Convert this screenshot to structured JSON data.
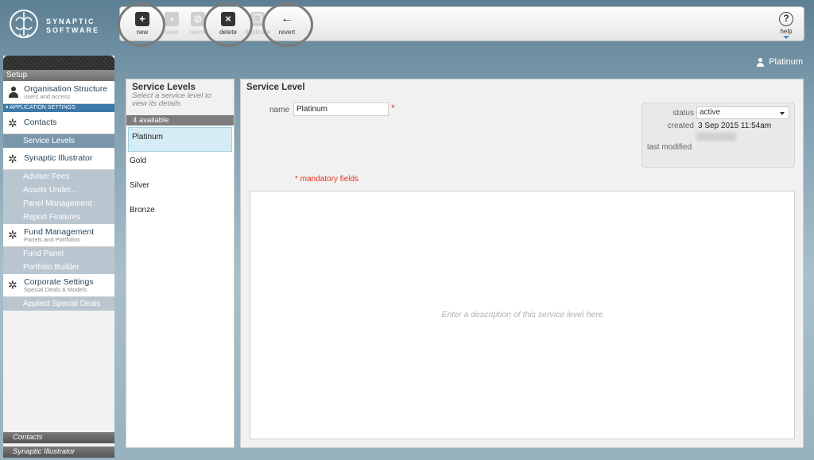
{
  "brand": {
    "line1": "SYNAPTIC",
    "line2": "SOFTWARE"
  },
  "toolbar": {
    "new_label": "new",
    "save_label": "save",
    "cancel_label": "cancel",
    "delete_label": "delete",
    "duplicate_label": "duplicate",
    "revert_label": "revert",
    "help_label": "help"
  },
  "user": {
    "name": "Platinum"
  },
  "sidebar": {
    "setup_label": "Setup",
    "org": {
      "label": "Organisation Structure",
      "sub": "users and access"
    },
    "app_settings_label": "APPLICATION SETTINGS",
    "contacts": {
      "label": "Contacts"
    },
    "service_levels_label": "Service Levels",
    "illustrator": {
      "label": "Synaptic Illustrator"
    },
    "illustrator_sub": [
      "Adviser Fees",
      "Assets Under...",
      "Panel Management",
      "Report Features"
    ],
    "fund": {
      "label": "Fund Management",
      "sub": "Panels and Portfolios"
    },
    "fund_sub": [
      "Fund Panel",
      "Portfolio Builder"
    ],
    "corporate": {
      "label": "Corporate Settings",
      "sub": "Special Deals & Models"
    },
    "corporate_sub": [
      "Applied Special Deals"
    ],
    "bottom": [
      "Contacts",
      "Synaptic Illustrator"
    ]
  },
  "list": {
    "title": "Service Levels",
    "hint": "Select a service level to view its details",
    "count": "4 available",
    "items": [
      "Platinum",
      "Gold",
      "Silver",
      "Bronze"
    ]
  },
  "detail": {
    "title": "Service Level",
    "name_label": "name",
    "name_value": "Platinum",
    "required_mark": "*",
    "mandatory_note": "* mandatory fields",
    "status_label": "status",
    "status_value": "active",
    "created_label": "created",
    "created_value": "3 Sep 2015 11:54am",
    "modified_label": "last modified",
    "description_placeholder": "Enter a description of this service level here"
  }
}
